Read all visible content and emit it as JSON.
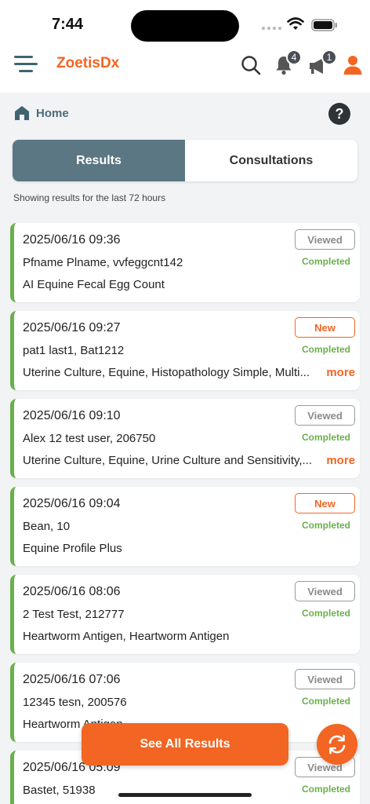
{
  "status_bar": {
    "time": "7:44"
  },
  "header": {
    "brand": "ZoetisDx",
    "notifications_count": "4",
    "announcements_count": "1"
  },
  "breadcrumb": {
    "label": "Home"
  },
  "help": {
    "label": "?"
  },
  "tabs": [
    {
      "label": "Results",
      "active": true
    },
    {
      "label": "Consultations",
      "active": false
    }
  ],
  "range_note": "Showing results for the last 72 hours",
  "results": [
    {
      "date": "2025/06/16 09:36",
      "patient": "Pfname Plname, vvfeggcnt142",
      "tests": "AI Equine Fecal Egg Count",
      "tag": "Viewed",
      "status": "Completed",
      "more": ""
    },
    {
      "date": "2025/06/16 09:27",
      "patient": "pat1 last1, Bat1212",
      "tests": "Uterine Culture, Equine, Histopathology Simple, Multi...",
      "tag": "New",
      "status": "Completed",
      "more": "more"
    },
    {
      "date": "2025/06/16 09:10",
      "patient": "Alex 12 test user, 206750",
      "tests": "Uterine Culture, Equine, Urine Culture and Sensitivity,...",
      "tag": "Viewed",
      "status": "Completed",
      "more": "more"
    },
    {
      "date": "2025/06/16 09:04",
      "patient": "Bean, 10",
      "tests": "Equine Profile Plus",
      "tag": "New",
      "status": "Completed",
      "more": ""
    },
    {
      "date": "2025/06/16 08:06",
      "patient": "2 Test Test, 212777",
      "tests": "Heartworm Antigen, Heartworm Antigen",
      "tag": "Viewed",
      "status": "Completed",
      "more": ""
    },
    {
      "date": "2025/06/16 07:06",
      "patient": "12345 tesn, 200576",
      "tests": "Heartworm Antigen",
      "tag": "Viewed",
      "status": "Completed",
      "more": ""
    },
    {
      "date": "2025/06/16 05:09",
      "patient": "Bastet, 51938",
      "tests": "",
      "tag": "Viewed",
      "status": "Completed",
      "more": ""
    }
  ],
  "see_all_label": "See All Results",
  "colors": {
    "brand_orange": "#f26522",
    "slate": "#5a7783",
    "completed_green": "#6ab04c"
  }
}
